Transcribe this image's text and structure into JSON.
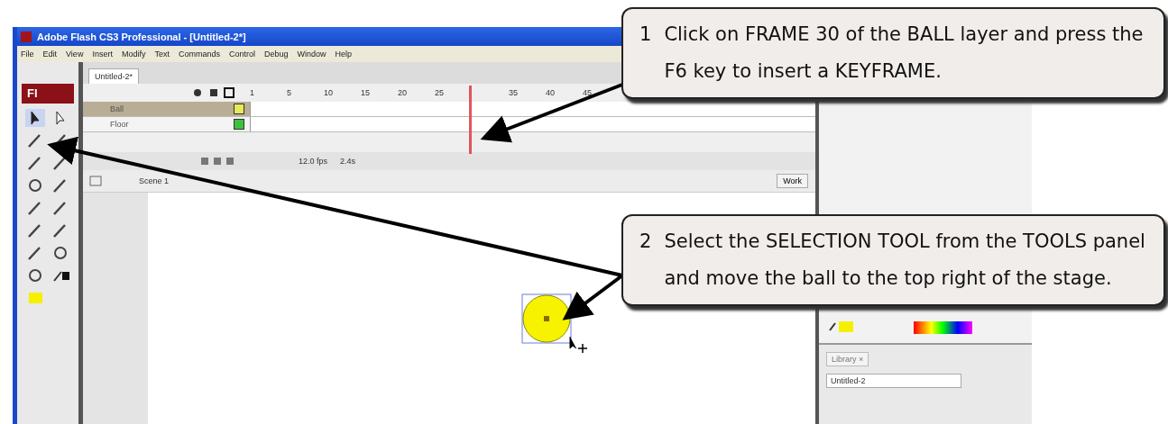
{
  "window": {
    "title": "Adobe Flash CS3 Professional - [Untitled-2*]",
    "logo": "Fl"
  },
  "menu": [
    "File",
    "Edit",
    "View",
    "Insert",
    "Modify",
    "Text",
    "Commands",
    "Control",
    "Debug",
    "Window",
    "Help"
  ],
  "document_tabs": [
    {
      "label": "Untitled-2*",
      "selected": true
    }
  ],
  "timeline": {
    "frame_numbers": [
      "1",
      "5",
      "10",
      "15",
      "20",
      "25",
      "35",
      "40",
      "45"
    ],
    "layers": [
      {
        "name": "Ball",
        "selected": true,
        "color": "#e6ea5a"
      },
      {
        "name": "Floor",
        "selected": false,
        "color": "#3cc23c"
      }
    ],
    "frame_rate": "12.0 fps",
    "elapsed": "2.4s"
  },
  "edit_bar": {
    "scene": "Scene 1",
    "workspace_button": "Work"
  },
  "library": {
    "tab": "Library ×",
    "document": "Untitled-2"
  },
  "callouts": [
    {
      "number": "1",
      "text": "Click on FRAME 30 of the BALL layer and press the F6 key to insert a KEYFRAME."
    },
    {
      "number": "2",
      "text": "Select the SELECTION TOOL from the TOOLS panel and move the ball to the top right of the stage."
    }
  ]
}
